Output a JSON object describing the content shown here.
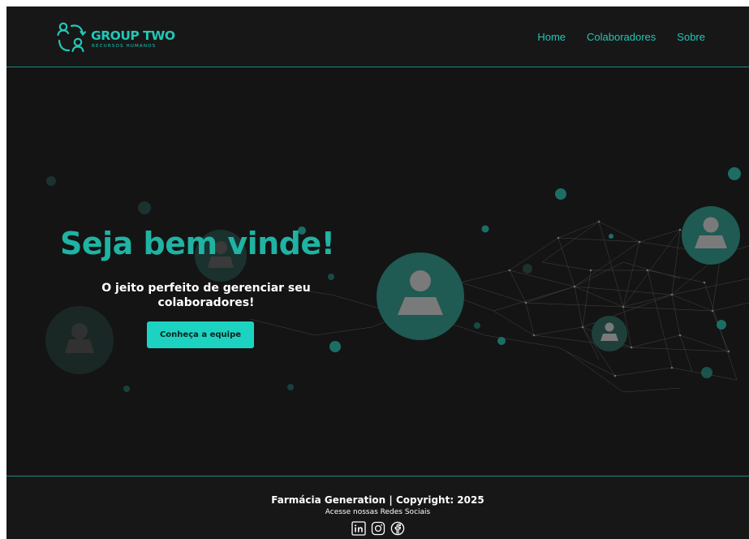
{
  "brand": {
    "name": "GROUP TWO",
    "tagline": "RECURSOS HUMANOS"
  },
  "nav": {
    "items": [
      {
        "label": "Home"
      },
      {
        "label": "Colaboradores"
      },
      {
        "label": "Sobre"
      }
    ]
  },
  "hero": {
    "title": "Seja bem vinde!",
    "subtitle": "O jeito perfeito de gerenciar seu colaboradores!",
    "cta_label": "Conheça a equipe"
  },
  "footer": {
    "copyright": "Farmácia Generation | Copyright: 2025",
    "social_label": "Acesse nossas Redes Sociais",
    "socials": [
      "linkedin-icon",
      "instagram-icon",
      "facebook-icon"
    ]
  },
  "colors": {
    "accent": "#22c7b5",
    "button": "#1cd3c2",
    "background": "#141414"
  }
}
